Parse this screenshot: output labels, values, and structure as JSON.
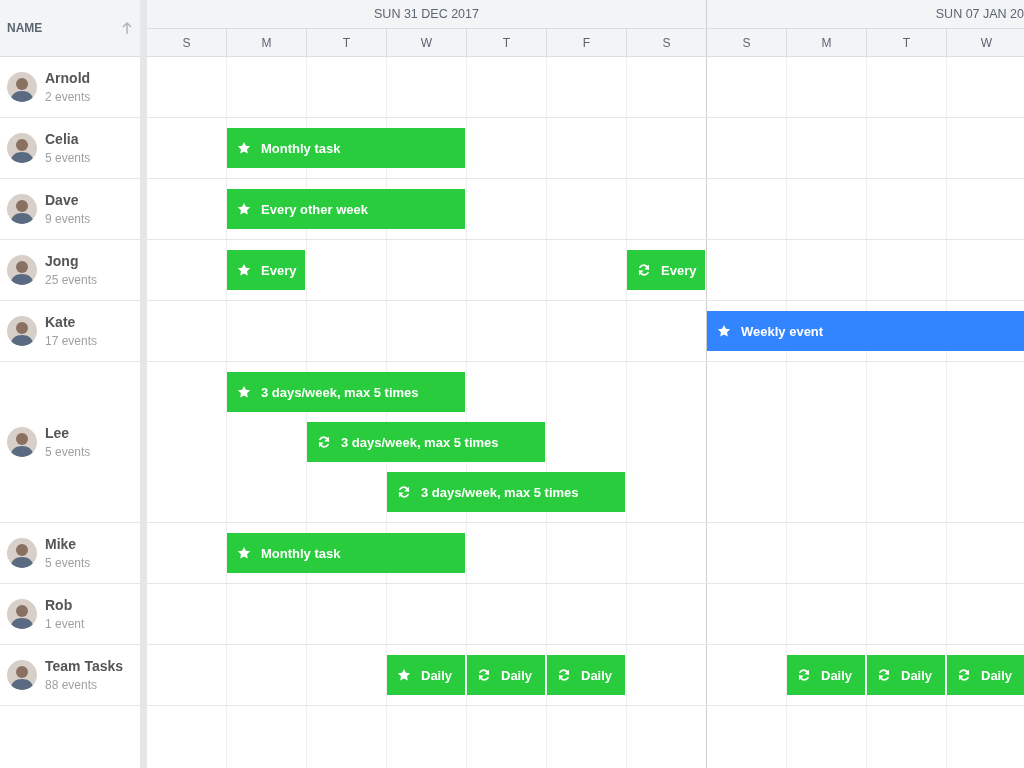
{
  "name_column": {
    "label": "NAME",
    "sorted": true
  },
  "weeks": [
    {
      "label": "SUN 31 DEC 2017"
    },
    {
      "label": "SUN 07 JAN 20"
    }
  ],
  "days": [
    "S",
    "M",
    "T",
    "W",
    "T",
    "F",
    "S",
    "S",
    "M",
    "T",
    "W"
  ],
  "resources": [
    {
      "name": "Arnold",
      "count": "2 events"
    },
    {
      "name": "Celia",
      "count": "5 events",
      "events": [
        {
          "title": "Monthly task",
          "kind": "star",
          "color": "#28cc3c"
        }
      ]
    },
    {
      "name": "Dave",
      "count": "9 events",
      "events": [
        {
          "title": "Every other week",
          "kind": "star",
          "color": "#28cc3c"
        }
      ]
    },
    {
      "name": "Jong",
      "count": "25 events",
      "events": [
        {
          "title": "Every",
          "kind": "star",
          "color": "#28cc3c"
        },
        {
          "title": "Every",
          "kind": "recurring",
          "color": "#28cc3c"
        }
      ]
    },
    {
      "name": "Kate",
      "count": "17 events",
      "events": [
        {
          "title": "Weekly event",
          "kind": "star",
          "color": "#3385ff"
        }
      ]
    },
    {
      "name": "Lee",
      "count": "5 events",
      "events": [
        {
          "title": "3 days/week, max 5 times",
          "kind": "star",
          "color": "#28cc3c"
        },
        {
          "title": "3 days/week, max 5 times",
          "kind": "recurring",
          "color": "#28cc3c"
        },
        {
          "title": "3 days/week, max 5 times",
          "kind": "recurring",
          "color": "#28cc3c"
        }
      ]
    },
    {
      "name": "Mike",
      "count": "5 events",
      "events": [
        {
          "title": "Monthly task",
          "kind": "star",
          "color": "#28cc3c"
        }
      ]
    },
    {
      "name": "Rob",
      "count": "1 event"
    },
    {
      "name": "Team Tasks",
      "count": "88 events",
      "events": [
        {
          "title": "Daily",
          "kind": "star",
          "color": "#28cc3c"
        },
        {
          "title": "Daily",
          "kind": "recurring",
          "color": "#28cc3c"
        },
        {
          "title": "Daily",
          "kind": "recurring",
          "color": "#28cc3c"
        },
        {
          "title": "Daily",
          "kind": "recurring",
          "color": "#28cc3c"
        },
        {
          "title": "Daily",
          "kind": "recurring",
          "color": "#28cc3c"
        },
        {
          "title": "Daily",
          "kind": "recurring",
          "color": "#28cc3c"
        }
      ]
    }
  ]
}
